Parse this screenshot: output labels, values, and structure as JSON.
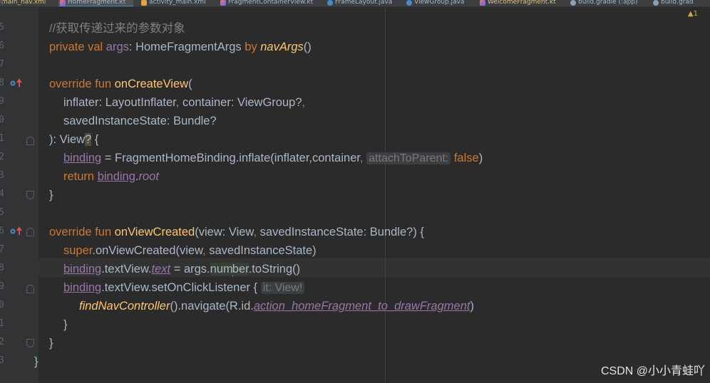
{
  "tabs": [
    {
      "label": "main_nav.xml",
      "kind": "xmlname"
    },
    {
      "label": "HomeFragment.kt",
      "kind": "kt",
      "active": true
    },
    {
      "label": "activity_main.xml",
      "kind": "xml"
    },
    {
      "label": "FragmentContainerView.kt",
      "kind": "kt"
    },
    {
      "label": "FrameLayout.java",
      "kind": "java"
    },
    {
      "label": "ViewGroup.java",
      "kind": "java"
    },
    {
      "label": "WelcomeFragment.kt",
      "kind": "kotname"
    },
    {
      "label": "build.gradle (:app)",
      "kind": "gradle"
    },
    {
      "label": "build.grad",
      "kind": "gradle"
    }
  ],
  "warnings": {
    "count": "1"
  },
  "line_numbers": [
    "4",
    "5",
    "6",
    "7",
    "8",
    "9",
    "0",
    "1",
    "2",
    "3",
    "4",
    "5",
    "6",
    "7",
    "8",
    "9",
    "0",
    "1",
    "2",
    "3"
  ],
  "code": {
    "comment": "//获取传递过来的参数对象",
    "l_args": {
      "kw": "private val ",
      "name": "args",
      "p1": ": HomeFragmentArgs ",
      "by": "by",
      "sp": " ",
      "fn": "navArgs",
      "end": "()"
    },
    "l_oncreate": {
      "kw": "override fun ",
      "fn": "onCreateView",
      "end": "("
    },
    "l_params1": {
      "a": "inflater: LayoutInflater",
      "c": ",",
      "b": " container: ViewGroup?",
      "d": ","
    },
    "l_params2": {
      "a": "savedInstanceState: Bundle?"
    },
    "l_ret": {
      "a": "): View",
      "q": "?",
      "b": " {"
    },
    "l_binding": {
      "b": "binding",
      "eq": " = FragmentHomeBinding.inflate(inflater,container",
      "c": ",",
      "hint": "attachToParent:",
      "val": "false",
      "end": ")"
    },
    "l_return": {
      "kw": "return ",
      "b": "binding",
      "dot": ".",
      "root": "root"
    },
    "brace": "}",
    "l_onview": {
      "kw": "override fun ",
      "fn": "onViewCreated",
      "p": "(view: View",
      "c": ",",
      "p2": " savedInstanceState: Bundle?) {"
    },
    "l_super": {
      "kw": "super",
      "rest": ".onViewCreated(view",
      "c": ",",
      "rest2": " savedInstanceState)"
    },
    "l_text": {
      "b": "binding",
      "t": ".textView.",
      "text": "text",
      "eq": " = args.",
      "num1": "num",
      "num2": "ber",
      "end": ".toString()"
    },
    "l_click": {
      "b": "binding",
      "t": ".textView.setOnClickListener { ",
      "hint": "it: View!"
    },
    "l_nav": {
      "fn": "findNavController",
      "mid": "().navigate(R.id.",
      "action": "action_homeFragment_to_drawFragment",
      "end": ")"
    }
  },
  "watermark": "CSDN @小小青蛙吖"
}
